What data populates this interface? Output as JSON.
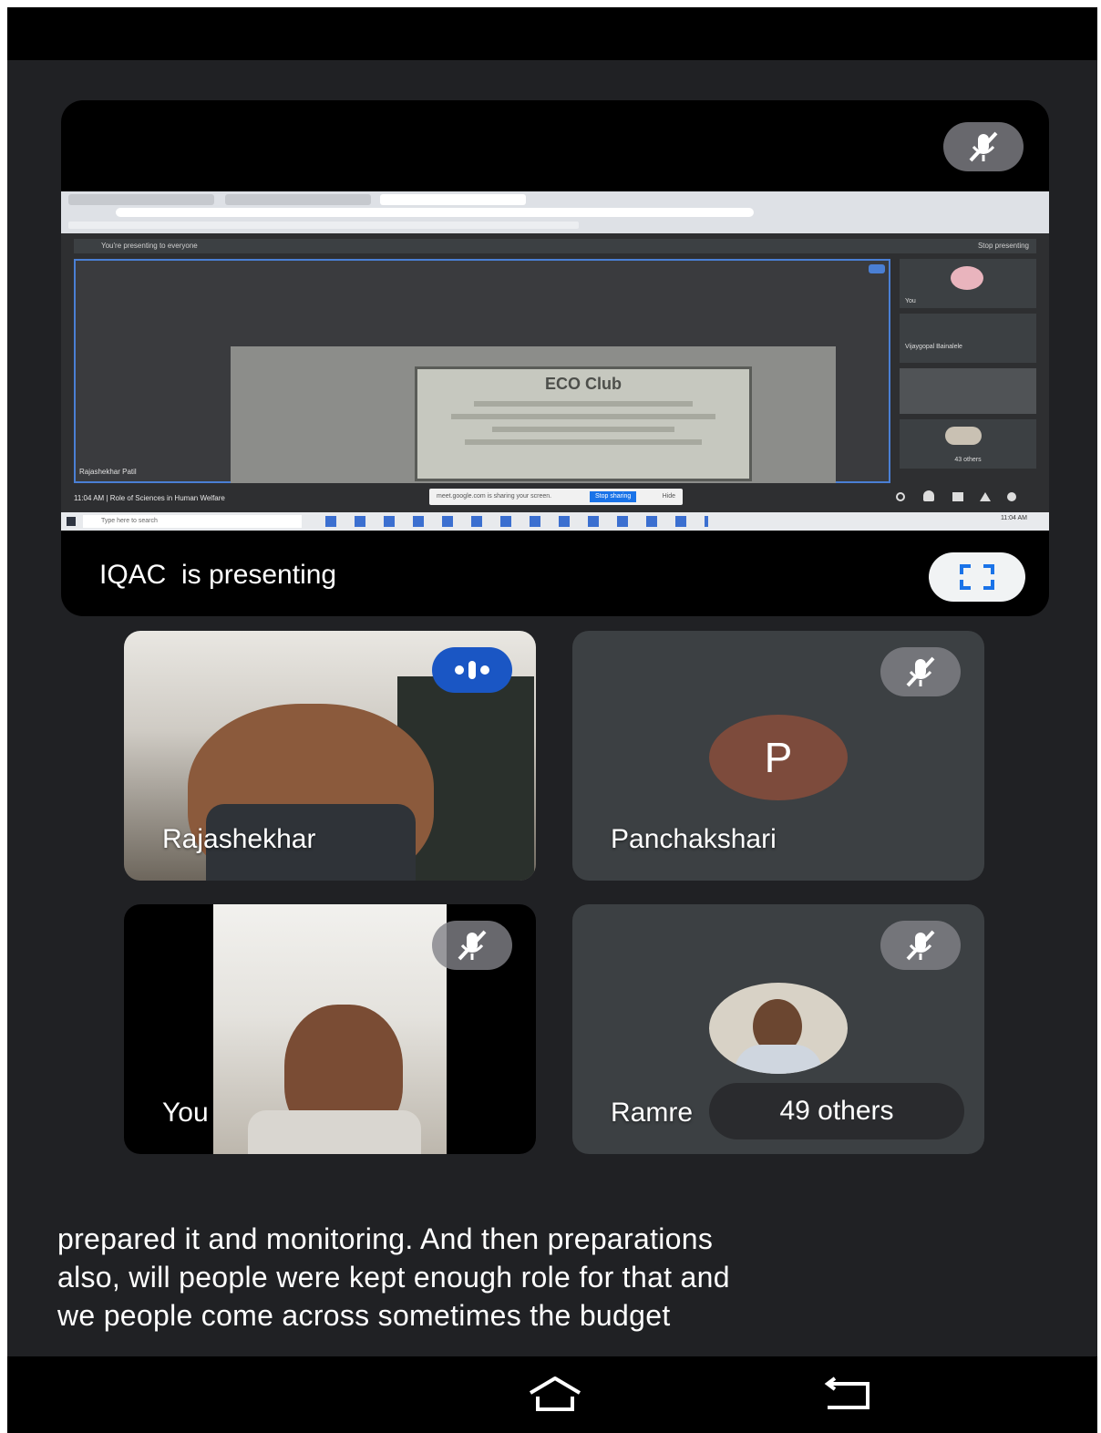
{
  "presentation": {
    "label": "IQAC  is presenting",
    "shared_screen": {
      "banner": "You're presenting to everyone",
      "stop_label": "Stop presenting",
      "slide_title": "ECO Club",
      "speaker_name": "Rajashekhar Patil",
      "meeting_info": "11:04 AM  |  Role of Sciences in Human Welfare",
      "self_label": "You",
      "participant_2": "Vijaygopal Bainalele",
      "others_label": "43 others",
      "sharing_notice": "meet.google.com is sharing your screen.",
      "stop_sharing_label": "Stop sharing",
      "hide_label": "Hide",
      "taskbar_search": "Type here to search",
      "clock": "11:04 AM"
    }
  },
  "tiles": [
    {
      "name": "Rajashekhar",
      "state": "speaking"
    },
    {
      "name": "Panchakshari",
      "avatar_letter": "P",
      "state": "muted"
    },
    {
      "name": "You",
      "state": "muted"
    },
    {
      "name": "Ramre",
      "state": "muted",
      "overlay": "49 others"
    }
  ],
  "caption_lines": [
    "prepared it and monitoring. And then preparations",
    "also, will people were kept enough role for that and",
    "we people come across sometimes the budget"
  ],
  "colors": {
    "background": "#202124",
    "speaking_badge": "#1a56c4",
    "avatar_p": "#7d4b3c",
    "tile": "#3c4043"
  }
}
